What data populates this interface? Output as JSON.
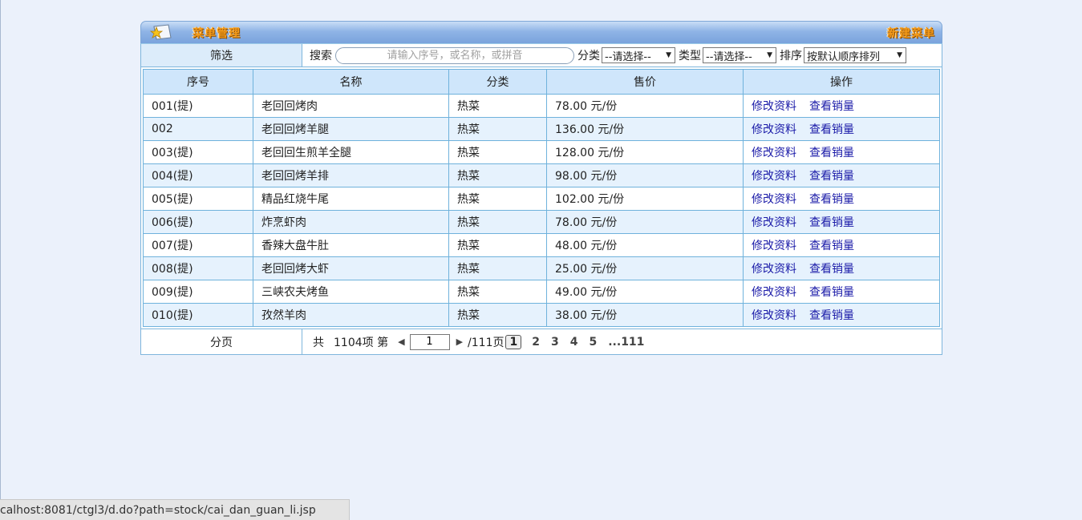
{
  "header": {
    "title": "菜单管理",
    "new_label": "新建菜单"
  },
  "filter": {
    "label": "筛选",
    "search_label": "搜索",
    "search_placeholder": "请输入序号，或名称，或拼音",
    "category_label": "分类",
    "category_value": "--请选择--",
    "type_label": "类型",
    "type_value": "--请选择--",
    "sort_label": "排序",
    "sort_value": "按默认顺序排列"
  },
  "table": {
    "columns": [
      "序号",
      "名称",
      "分类",
      "售价",
      "操作"
    ],
    "edit_label": "修改资料",
    "sales_label": "查看销量",
    "rows": [
      {
        "id": "001(提)",
        "name": "老回回烤肉",
        "category": "热菜",
        "price": "78.00 元/份"
      },
      {
        "id": "002",
        "name": "老回回烤羊腿",
        "category": "热菜",
        "price": "136.00 元/份"
      },
      {
        "id": "003(提)",
        "name": "老回回生煎羊全腿",
        "category": "热菜",
        "price": "128.00 元/份"
      },
      {
        "id": "004(提)",
        "name": "老回回烤羊排",
        "category": "热菜",
        "price": "98.00 元/份"
      },
      {
        "id": "005(提)",
        "name": "精品红烧牛尾",
        "category": "热菜",
        "price": "102.00 元/份"
      },
      {
        "id": "006(提)",
        "name": "炸烹虾肉",
        "category": "热菜",
        "price": "78.00 元/份"
      },
      {
        "id": "007(提)",
        "name": "香辣大盘牛肚",
        "category": "热菜",
        "price": "48.00 元/份"
      },
      {
        "id": "008(提)",
        "name": "老回回烤大虾",
        "category": "热菜",
        "price": "25.00 元/份"
      },
      {
        "id": "009(提)",
        "name": "三峡农夫烤鱼",
        "category": "热菜",
        "price": "49.00 元/份"
      },
      {
        "id": "010(提)",
        "name": "孜然羊肉",
        "category": "热菜",
        "price": "38.00 元/份"
      }
    ]
  },
  "pager": {
    "label": "分页",
    "total_prefix": "共",
    "total_text": "1104项 第",
    "current_page": "1",
    "total_pages_text": "/111页",
    "pages": [
      "1",
      "2",
      "3",
      "4",
      "5",
      "...111"
    ]
  },
  "status_bar": {
    "url": "calhost:8081/ctgl3/d.do?path=stock/cai_dan_guan_li.jsp"
  }
}
